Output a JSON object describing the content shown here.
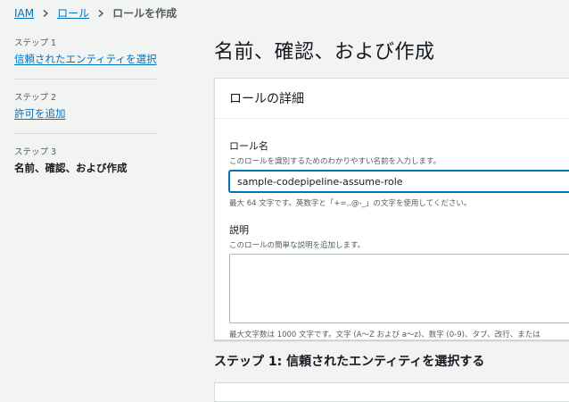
{
  "breadcrumb": {
    "items": [
      "IAM",
      "ロール"
    ],
    "current": "ロールを作成"
  },
  "sidebar": {
    "steps": [
      {
        "number": "ステップ 1",
        "label": "信頼されたエンティティを選択"
      },
      {
        "number": "ステップ 2",
        "label": "許可を追加"
      },
      {
        "number": "ステップ 3",
        "label": "名前、確認、および作成"
      }
    ]
  },
  "page": {
    "title": "名前、確認、および作成"
  },
  "role_details": {
    "header": "ロールの詳細",
    "role_name": {
      "label": "ロール名",
      "description": "このロールを識別するためのわかりやすい名前を入力します。",
      "value": "sample-codepipeline-assume-role",
      "constraint": "最大 64 文字です。英数字と「+=,.@-_」の文字を使用してください。"
    },
    "description": {
      "label": "説明",
      "description": "このロールの簡単な説明を追加します。",
      "value": "",
      "constraint": "最大文字数は 1000 文字です。文字 (A〜Z および a〜z)、数字 (0-9)、タブ、改行、または"
    }
  },
  "step1_section": {
    "heading": "ステップ 1: 信頼されたエンティティを選択する"
  },
  "colors": {
    "link": "#0073bb",
    "background": "#f2f3f3",
    "card": "#ffffff",
    "border": "#d5dbdb"
  }
}
